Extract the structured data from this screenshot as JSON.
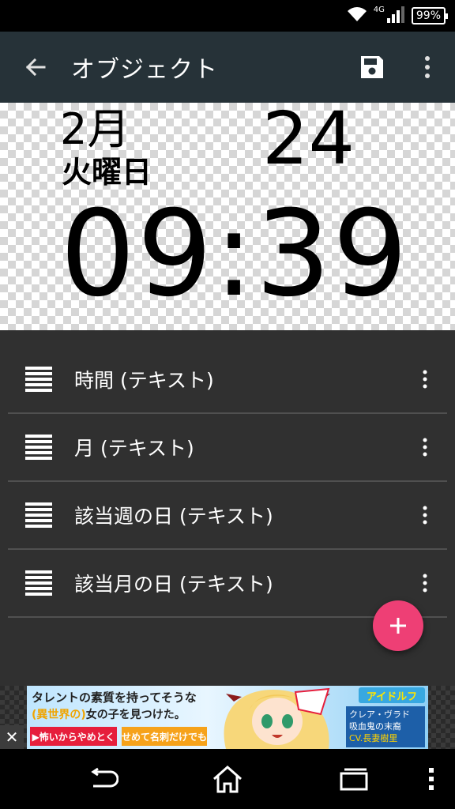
{
  "status_bar": {
    "network_label": "4G",
    "battery": "99%"
  },
  "toolbar": {
    "title": "オブジェクト",
    "back_icon": "arrow-left-icon",
    "save_icon": "floppy-save-icon",
    "menu_icon": "more-vert-icon"
  },
  "preview": {
    "month": "2月",
    "weekday": "火曜日",
    "day": "24",
    "time": "09:39"
  },
  "objects": [
    {
      "label": "時間 (テキスト)"
    },
    {
      "label": "月 (テキスト)"
    },
    {
      "label": "該当週の日 (テキスト)"
    },
    {
      "label": "該当月の日 (テキスト)"
    }
  ],
  "fab": {
    "icon": "plus-icon"
  },
  "ad": {
    "close": "✕",
    "line1": "タレントの素質を持ってそうな",
    "line2_highlight": "(異世界の)",
    "line2_rest": "女の子を見つけた。",
    "button1": "▶怖いからやめとく",
    "button2": "せめて名刺だけでも",
    "logo": "アイドルフ",
    "info_line1": "クレア・ヴラド",
    "info_line2": "吸血鬼の末裔",
    "info_cv": "CV.長妻樹里"
  },
  "nav": {
    "back_icon": "nav-back-icon",
    "home_icon": "nav-home-icon",
    "recents_icon": "nav-recents-icon",
    "menu_icon": "nav-menu-icon"
  }
}
